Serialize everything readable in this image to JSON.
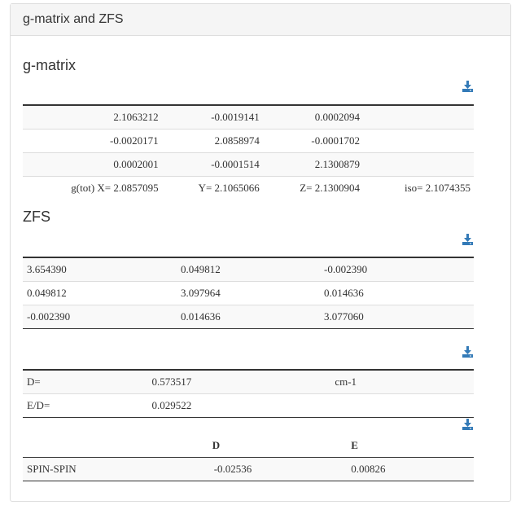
{
  "panel": {
    "title": "g-matrix and ZFS"
  },
  "gmatrix": {
    "title": "g-matrix",
    "rows": [
      [
        "2.1063212",
        "-0.0019141",
        "0.0002094",
        ""
      ],
      [
        "-0.0020171",
        "2.0858974",
        "-0.0001702",
        ""
      ],
      [
        "0.0002001",
        "-0.0001514",
        "2.1300879",
        ""
      ],
      [
        "g(tot) X= 2.0857095",
        "Y= 2.1065066",
        "Z= 2.1300904",
        "iso= 2.1074355"
      ]
    ]
  },
  "zfs": {
    "title": "ZFS",
    "rows": [
      [
        "3.654390",
        "0.049812",
        "-0.002390"
      ],
      [
        "0.049812",
        "3.097964",
        "0.014636"
      ],
      [
        "-0.002390",
        "0.014636",
        "3.077060"
      ]
    ]
  },
  "de": {
    "rows": [
      [
        "D=",
        "0.573517",
        "cm-1"
      ],
      [
        "E/D=",
        "0.029522",
        ""
      ]
    ]
  },
  "spin": {
    "headers": [
      "",
      "D",
      "E"
    ],
    "row": [
      "SPIN-SPIN",
      "-0.02536",
      "0.00826"
    ]
  },
  "icons": {
    "download": "download-icon"
  },
  "colors": {
    "accent": "#337ab7",
    "heading_bg": "#f5f5f5",
    "stripe": "#f9f9f9"
  }
}
